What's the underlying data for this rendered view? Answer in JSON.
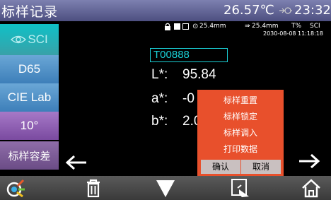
{
  "header": {
    "title": "标样记录",
    "temperature": "26.57℃",
    "time": "23:32"
  },
  "sidebar": {
    "items": [
      {
        "label": "SCI",
        "icon": "eye-icon"
      },
      {
        "label": "D65"
      },
      {
        "label": "CIE Lab"
      },
      {
        "label": "10°"
      },
      {
        "label": "标样容差"
      }
    ]
  },
  "status": {
    "aperture_1": "25.4mm",
    "aperture_2": "25.4mm",
    "mode": "T%",
    "sci": "SCI",
    "datetime": "2030-08-08 11:18:18"
  },
  "sample": {
    "name": "T00888",
    "readings": [
      {
        "label": "L*:",
        "value": "95.84"
      },
      {
        "label": "a*:",
        "value": "-0"
      },
      {
        "label": "b*:",
        "value": "2.0"
      }
    ]
  },
  "menu": {
    "items": [
      "标样重置",
      "标样锁定",
      "标样调入",
      "打印数据"
    ],
    "ok_label": "确认",
    "cancel_label": "取消"
  },
  "colors": {
    "accent_cyan": "#1ad0d6",
    "menu_bg": "#e8502c",
    "topbar": "#5e6192"
  }
}
